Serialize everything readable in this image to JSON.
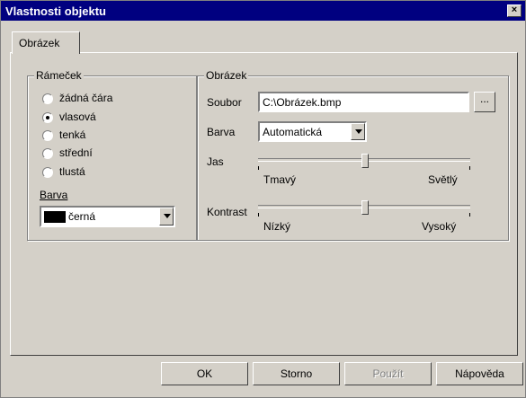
{
  "window": {
    "title": "Vlastnosti objektu",
    "close_label": "×"
  },
  "tabs": [
    {
      "label": "Obrázek"
    }
  ],
  "frame": {
    "legend": "Rámeček",
    "options": [
      {
        "label": "žádná čára",
        "selected": false
      },
      {
        "label": "vlasová",
        "selected": true
      },
      {
        "label": "tenká",
        "selected": false
      },
      {
        "label": "střední",
        "selected": false
      },
      {
        "label": "tlustá",
        "selected": false
      }
    ],
    "color_label": "Barva",
    "color_value": "černá",
    "color_swatch": "#000000"
  },
  "image": {
    "legend": "Obrázek",
    "file_label": "Soubor",
    "file_value": "C:\\Obrázek.bmp",
    "browse_label": "...",
    "color_label": "Barva",
    "color_value": "Automatická",
    "brightness": {
      "label": "Jas",
      "min_label": "Tmavý",
      "max_label": "Světlý",
      "value": 0.5
    },
    "contrast": {
      "label": "Kontrast",
      "min_label": "Nízký",
      "max_label": "Vysoký",
      "value": 0.5
    }
  },
  "buttons": {
    "ok": "OK",
    "cancel": "Storno",
    "apply": "Použít",
    "help": "Nápověda"
  }
}
